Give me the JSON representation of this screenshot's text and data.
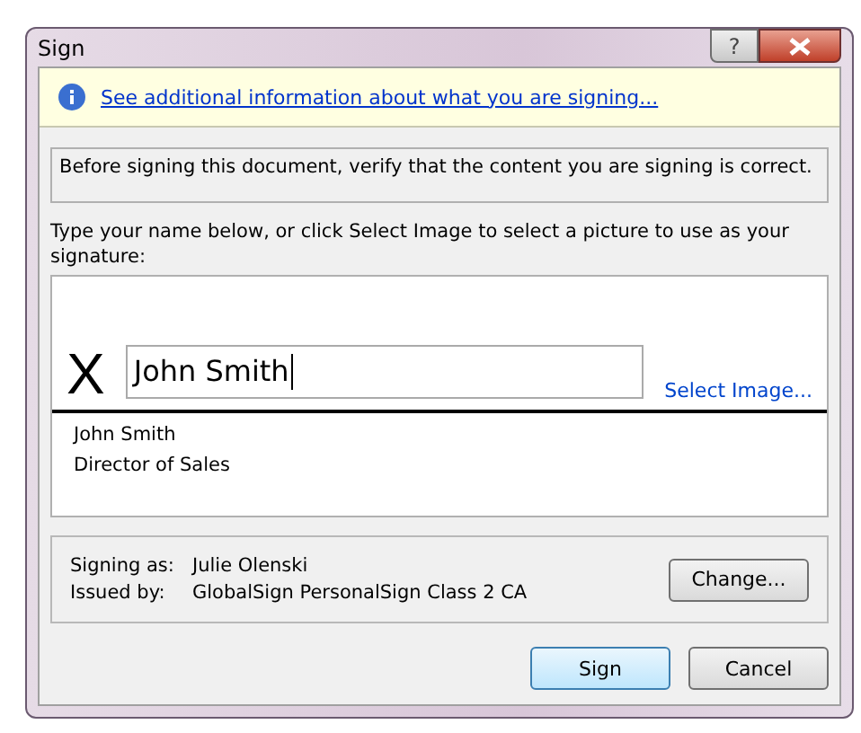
{
  "window": {
    "title": "Sign",
    "help_button": "?"
  },
  "info_bar": {
    "link": "See additional information about what you are signing..."
  },
  "statement": "Before signing this document, verify that the content you are signing is correct.",
  "instruction": "Type your name below, or click Select Image to select a picture to use as your signature:",
  "signature": {
    "mark": "X",
    "value": "John Smith",
    "select_image": "Select Image...",
    "signer_lines": [
      "John Smith",
      "Director of Sales"
    ]
  },
  "signer": {
    "rows": [
      {
        "label": "Signing as:",
        "value": "Julie Olenski"
      },
      {
        "label": "Issued by:",
        "value": "GlobalSign PersonalSign Class 2 CA"
      }
    ],
    "change_button": "Change..."
  },
  "buttons": [
    {
      "label": "Sign",
      "selected": true
    },
    {
      "label": "Cancel",
      "selected": false
    }
  ]
}
